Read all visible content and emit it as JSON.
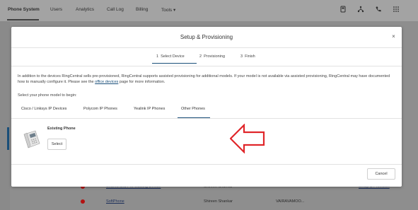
{
  "topnav": {
    "items": [
      "Phone System",
      "Users",
      "Analytics",
      "Call Log",
      "Billing",
      "Tools ▾"
    ],
    "active_index": 0,
    "icons": [
      "device-icon",
      "network-icon",
      "phone-icon",
      "grid-icon"
    ]
  },
  "background_rows": [
    {
      "name": "Shared and Pre-existing Device",
      "user": "Shireen Shankar",
      "date": "",
      "link": "Setup & Provision"
    },
    {
      "name": "SoftPhone",
      "user": "Shireen Shankar",
      "date": "VAIRAVAMOO...",
      "link": ""
    }
  ],
  "modal": {
    "title": "Setup & Provisioning",
    "close_label": "×",
    "steps": [
      {
        "num": "1",
        "label": "Select Device"
      },
      {
        "num": "2",
        "label": "Provisioning"
      },
      {
        "num": "3",
        "label": "Finish"
      }
    ],
    "info_text_1": "In addition to the devices RingCentral sells pre-provisioned, RingCentral supports assisted provisioning for additional models. If your model is not available via assisted provisioning, RingCentral may have documented how to manually configure it. Please see the ",
    "info_link": "office devices",
    "info_text_2": " page for more information.",
    "prompt": "Select your phone model to begin:",
    "tabs": [
      "Cisco / Linksys IP Devices",
      "Polycom IP Phones",
      "Yealink IP Phones",
      "Other Phones"
    ],
    "active_tab_index": 3,
    "device": {
      "name": "Existing Phone",
      "button_label": "Select"
    },
    "cancel_label": "Cancel"
  },
  "colors": {
    "accent": "#1a4f7a",
    "annotation_arrow": "#e0262a",
    "status_dot": "#b31212"
  }
}
